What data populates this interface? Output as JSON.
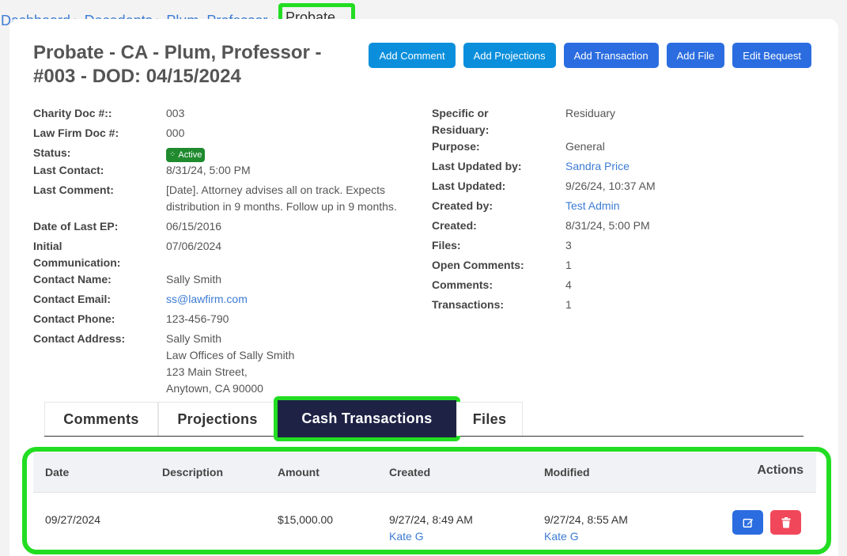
{
  "breadcrumb": {
    "items": [
      "Dashboard",
      "Decedents",
      "Plum, Professor"
    ],
    "current": "Probate"
  },
  "page": {
    "title": "Probate - CA - Plum, Professor - #003 - DOD: 04/15/2024"
  },
  "buttons": {
    "add_comment": "Add Comment",
    "add_projections": "Add Projections",
    "add_transaction": "Add Transaction",
    "add_file": "Add File",
    "edit_bequest": "Edit Bequest"
  },
  "left": {
    "charity_doc_label": "Charity Doc #::",
    "charity_doc": "003",
    "law_firm_doc_label": "Law Firm Doc #:",
    "law_firm_doc": "000",
    "status_label": "Status:",
    "status": "Active",
    "last_contact_label": "Last Contact:",
    "last_contact": "8/31/24, 5:00 PM",
    "last_comment_label": "Last Comment:",
    "last_comment": "[Date]. Attorney advises all on track. Expects distribution in 9 months. Follow up in 9 months.",
    "date_last_ep_label": "Date of Last EP:",
    "date_last_ep": "06/15/2016",
    "initial_comm_label": "Initial Communication:",
    "initial_comm": "07/06/2024",
    "contact_name_label": "Contact Name:",
    "contact_name": "Sally Smith",
    "contact_email_label": "Contact Email:",
    "contact_email": "ss@lawfirm.com",
    "contact_phone_label": "Contact Phone:",
    "contact_phone": "123-456-790",
    "contact_address_label": "Contact Address:",
    "address_line1": "Sally Smith",
    "address_line2": "Law Offices of Sally Smith",
    "address_line3": "123 Main Street,",
    "address_line4": "Anytown, CA 90000"
  },
  "right": {
    "specific_label": "Specific or Residuary:",
    "specific": "Residuary",
    "purpose_label": "Purpose:",
    "purpose": "General",
    "last_updated_by_label": "Last Updated by:",
    "last_updated_by": "Sandra Price",
    "last_updated_label": "Last Updated:",
    "last_updated": "9/26/24, 10:37 AM",
    "created_by_label": "Created by:",
    "created_by": "Test Admin",
    "created_label": "Created:",
    "created": "8/31/24, 5:00 PM",
    "files_label": "Files:",
    "files": "3",
    "open_comments_label": "Open Comments:",
    "open_comments": "1",
    "comments_label": "Comments:",
    "comments": "4",
    "transactions_label": "Transactions:",
    "transactions": "1"
  },
  "tabs": [
    "Comments",
    "Projections",
    "Cash Transactions",
    "Files"
  ],
  "table": {
    "headers": [
      "Date",
      "Description",
      "Amount",
      "Created",
      "Modified",
      "Actions"
    ],
    "rows": [
      {
        "date": "09/27/2024",
        "description": "",
        "amount": "$15,000.00",
        "created": "9/27/24, 8:49 AM",
        "created_by": "Kate G",
        "modified": "9/27/24, 8:55 AM",
        "modified_by": "Kate G"
      }
    ]
  },
  "icons": {
    "status": "spinner-icon",
    "edit": "edit-icon",
    "delete": "trash-icon"
  },
  "colors": {
    "highlight": "#22dd22",
    "primary": "#2b6de0",
    "cyan": "#0b8fdc",
    "active_tab": "#1e2245",
    "danger": "#f0485a",
    "status_active": "#1f8a2e"
  }
}
